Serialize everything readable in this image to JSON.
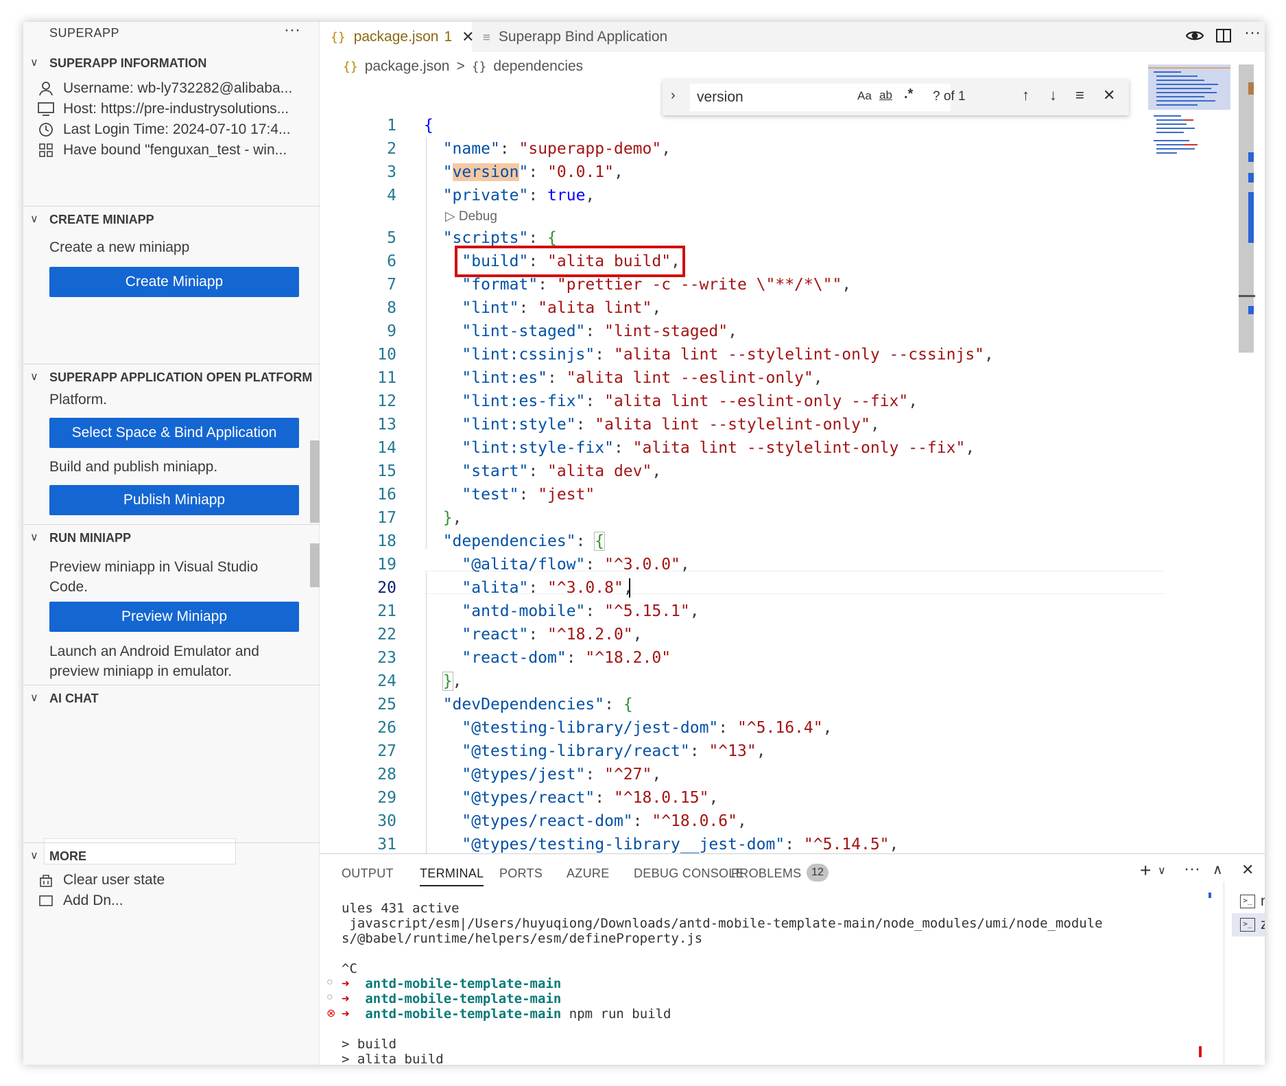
{
  "sidebar": {
    "title": "SUPERAPP",
    "more_icon": "ellipsis-icon",
    "info": {
      "header": "SUPERAPP INFORMATION",
      "username": "Username: wb-ly732282@alibaba...",
      "host": "Host: https://pre-industrysolutions...",
      "last_login": "Last Login Time: 2024-07-10 17:4...",
      "bound": "Have bound \"fenguxan_test - win..."
    },
    "create": {
      "header": "CREATE MINIAPP",
      "desc": "Create a new miniapp",
      "button": "Create Miniapp"
    },
    "platform": {
      "header": "SUPERAPP APPLICATION OPEN PLATFORM",
      "desc": "Platform.",
      "bind_button": "Select Space & Bind Application",
      "build_desc": "Build and publish miniapp.",
      "publish_button": "Publish Miniapp"
    },
    "run": {
      "header": "RUN MINIAPP",
      "desc_line1": "Preview miniapp in Visual Studio",
      "desc_line2": "Code.",
      "preview_button": "Preview Miniapp",
      "emu_line1": "Launch an Android Emulator and",
      "emu_line2": "preview miniapp in emulator."
    },
    "ai_chat": {
      "header": "AI CHAT"
    },
    "more": {
      "header": "MORE",
      "clear": "Clear user state",
      "next_partial": "Add Dn..."
    }
  },
  "tabs": [
    {
      "icon": "{}",
      "label": "package.json",
      "problems": "1",
      "active": true
    },
    {
      "icon": "≡",
      "label": "Superapp Bind Application",
      "active": false
    }
  ],
  "breadcrumb": {
    "file": "package.json",
    "sep": ">",
    "node_icon": "{}",
    "node": "dependencies"
  },
  "find": {
    "value": "version",
    "match_case": "Aa",
    "whole_word": "ab",
    "regex": ".*",
    "result": "? of 1"
  },
  "editor": {
    "current_line": 20,
    "codelens": "Debug",
    "line_numbers": [
      "1",
      "2",
      "3",
      "4",
      "5",
      "6",
      "7",
      "8",
      "9",
      "10",
      "11",
      "12",
      "13",
      "14",
      "15",
      "16",
      "17",
      "18",
      "19",
      "20",
      "21",
      "22",
      "23",
      "24",
      "25",
      "26",
      "27",
      "28",
      "29",
      "30",
      "31"
    ]
  },
  "panel": {
    "tabs": [
      "OUTPUT",
      "TERMINAL",
      "PORTS",
      "AZURE",
      "DEBUG CONSOLE",
      "PROBLEMS"
    ],
    "active_tab": "TERMINAL",
    "problems_count": "12",
    "terminal": {
      "l1": "ules 431 active",
      "l2": " javascript/esm|/Users/huyuqiong/Downloads/antd-mobile-template-main/node_modules/umi/node_module",
      "l3": "s/@babel/runtime/helpers/esm/defineProperty.js",
      "l4": "^C",
      "arrow": "➜",
      "dir": "antd-mobile-template-main",
      "cmd": " npm run build",
      "l8": "> build",
      "l9": "> alita build"
    },
    "shells": [
      "node",
      "zsh"
    ]
  }
}
